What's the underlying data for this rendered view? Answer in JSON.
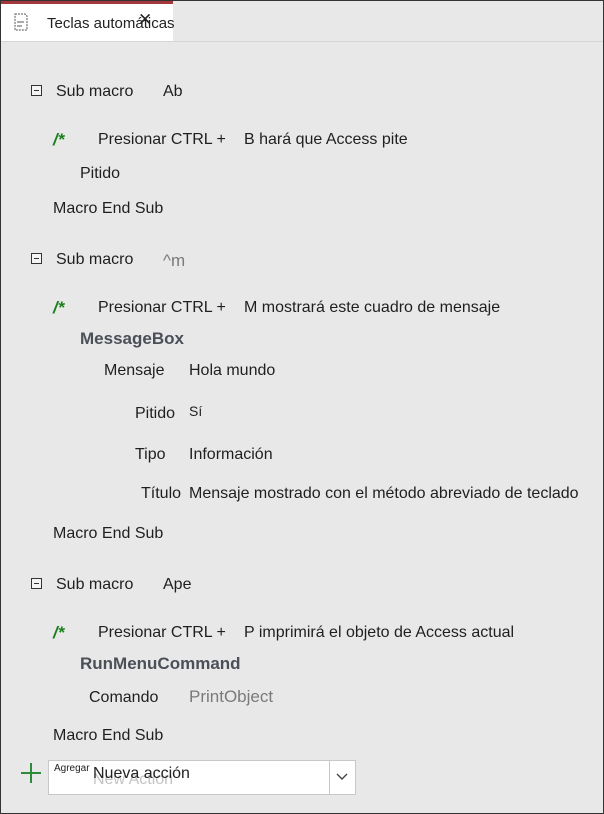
{
  "tab": {
    "title": "Teclas automáticas",
    "close": "✕"
  },
  "blocks": [
    {
      "sub_macro_label": "Sub macro",
      "name": "Ab",
      "comment_mark": "/*",
      "comment_prefix": "Presionar CTRL +",
      "comment_text": "B hará que Access pite",
      "action": "Pitido",
      "end_label": "Macro End Sub"
    },
    {
      "sub_macro_label": "Sub macro",
      "name": "^m",
      "comment_mark": "/*",
      "comment_prefix": "Presionar CTRL +",
      "comment_text": "M mostrará este cuadro de mensaje",
      "action": "MessageBox",
      "args": [
        {
          "label": "Mensaje",
          "value": "Hola mundo"
        },
        {
          "label": "Pitido",
          "value": "Sí"
        },
        {
          "label": "Tipo",
          "value": "Información"
        },
        {
          "label": "Título",
          "value": "Mensaje mostrado con el método abreviado de teclado"
        }
      ],
      "end_label": "Macro End Sub"
    },
    {
      "sub_macro_label": "Sub macro",
      "name": "Ape",
      "comment_mark": "/*",
      "comment_prefix": "Presionar CTRL +",
      "comment_text": "P imprimirá el objeto de Access actual",
      "action": "RunMenuCommand",
      "args": [
        {
          "label": "Comando",
          "value": "PrintObject"
        }
      ],
      "end_label": "Macro End Sub"
    }
  ],
  "add_action": {
    "label": "Agregar",
    "placeholder": "New Action",
    "value": "Nueva acción"
  },
  "colors": {
    "tab_accent": "#a4373a",
    "comment_green": "#1a7f1a",
    "add_plus_green": "#2e8b3a",
    "action_text": "#4b4f58"
  }
}
